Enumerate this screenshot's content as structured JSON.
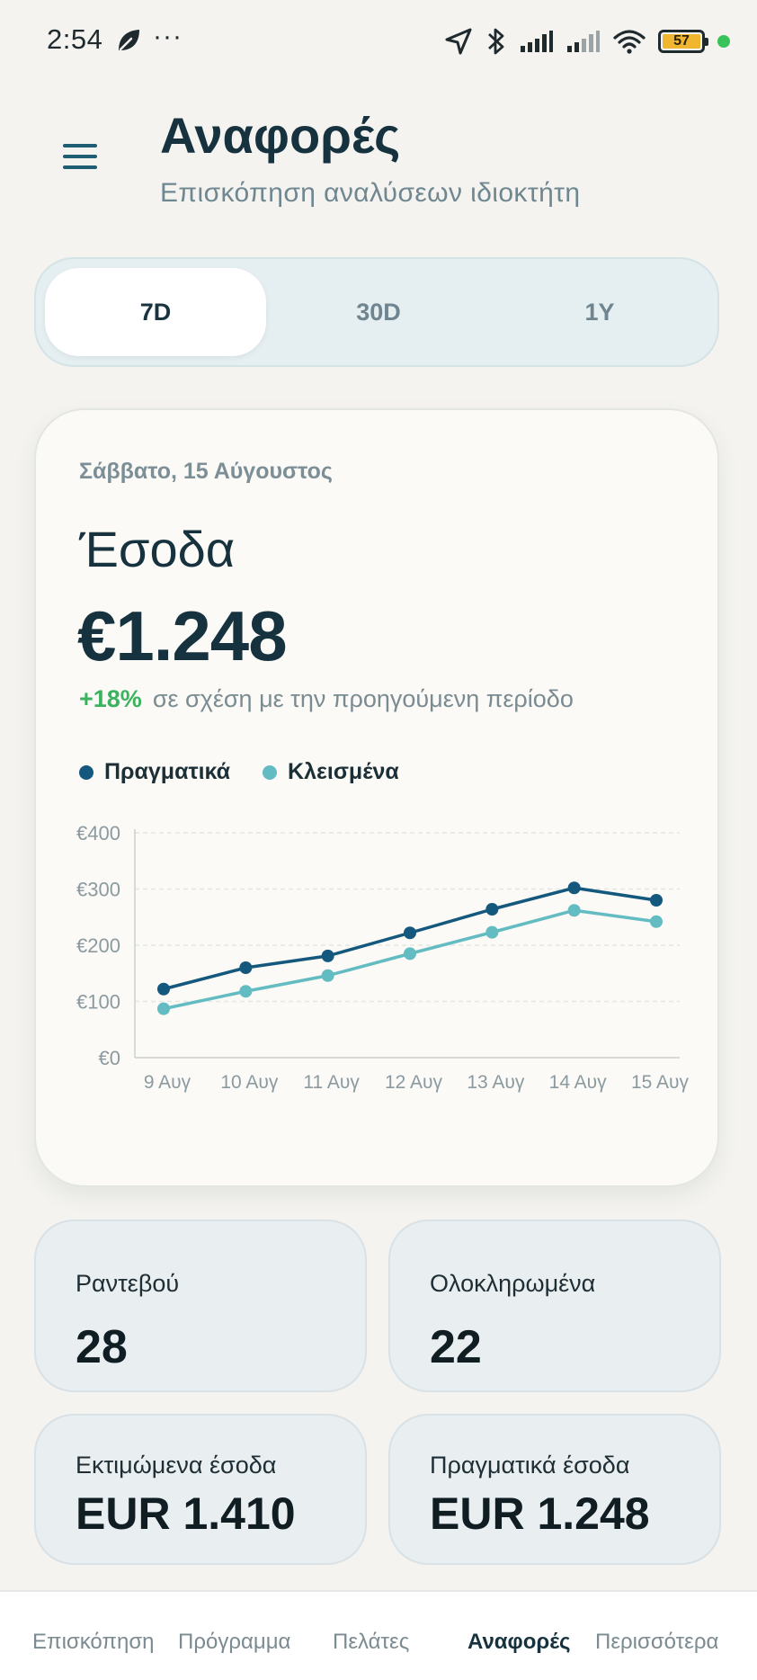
{
  "status_bar": {
    "time": "2:54",
    "dots": "···",
    "battery": "57",
    "icons": [
      "leaf-icon",
      "location-icon",
      "bluetooth-icon",
      "signal-icon",
      "signal-weak-icon",
      "wifi-icon",
      "battery-icon"
    ]
  },
  "header": {
    "title": "Αναφορές",
    "subtitle": "Επισκόπηση αναλύσεων ιδιοκτήτη"
  },
  "periods": [
    {
      "label": "7D",
      "active": true
    },
    {
      "label": "30D",
      "active": false
    },
    {
      "label": "1Y",
      "active": false
    }
  ],
  "revenue_card": {
    "date": "Σάββατο, 15 Αύγουστος",
    "heading": "Έσοδα",
    "amount": "€1.248",
    "change_pct": "+18%",
    "change_desc": "σε σχέση με την προηγούμενη περίοδο"
  },
  "chart_data": {
    "type": "line",
    "x": [
      "9 Αυγ",
      "10 Αυγ",
      "11 Αυγ",
      "12 Αυγ",
      "13 Αυγ",
      "14 Αυγ",
      "15 Αυγ"
    ],
    "y_ticks": [
      "€0",
      "€100",
      "€200",
      "€300",
      "€400"
    ],
    "ylim": [
      0,
      400
    ],
    "grid": true,
    "legend_position": "top-left",
    "series": [
      {
        "name": "Πραγματικά",
        "color": "#14587e",
        "values": [
          122,
          160,
          181,
          222,
          264,
          302,
          280
        ]
      },
      {
        "name": "Κλεισμένα",
        "color": "#63bcc2",
        "values": [
          87,
          118,
          146,
          185,
          223,
          262,
          242
        ]
      }
    ]
  },
  "stats": [
    {
      "label": "Ραντεβού",
      "value": "28"
    },
    {
      "label": "Ολοκληρωμένα",
      "value": "22"
    },
    {
      "label": "Εκτιμώμενα έσοδα",
      "value": "EUR 1.410"
    },
    {
      "label": "Πραγματικά έσοδα",
      "value": "EUR 1.248"
    }
  ],
  "nav": [
    {
      "label": "Επισκόπηση",
      "active": false
    },
    {
      "label": "Πρόγραμμα",
      "active": false
    },
    {
      "label": "Πελάτες",
      "active": false
    },
    {
      "label": "Αναφορές",
      "active": true
    },
    {
      "label": "Περισσότερα",
      "active": false
    }
  ]
}
